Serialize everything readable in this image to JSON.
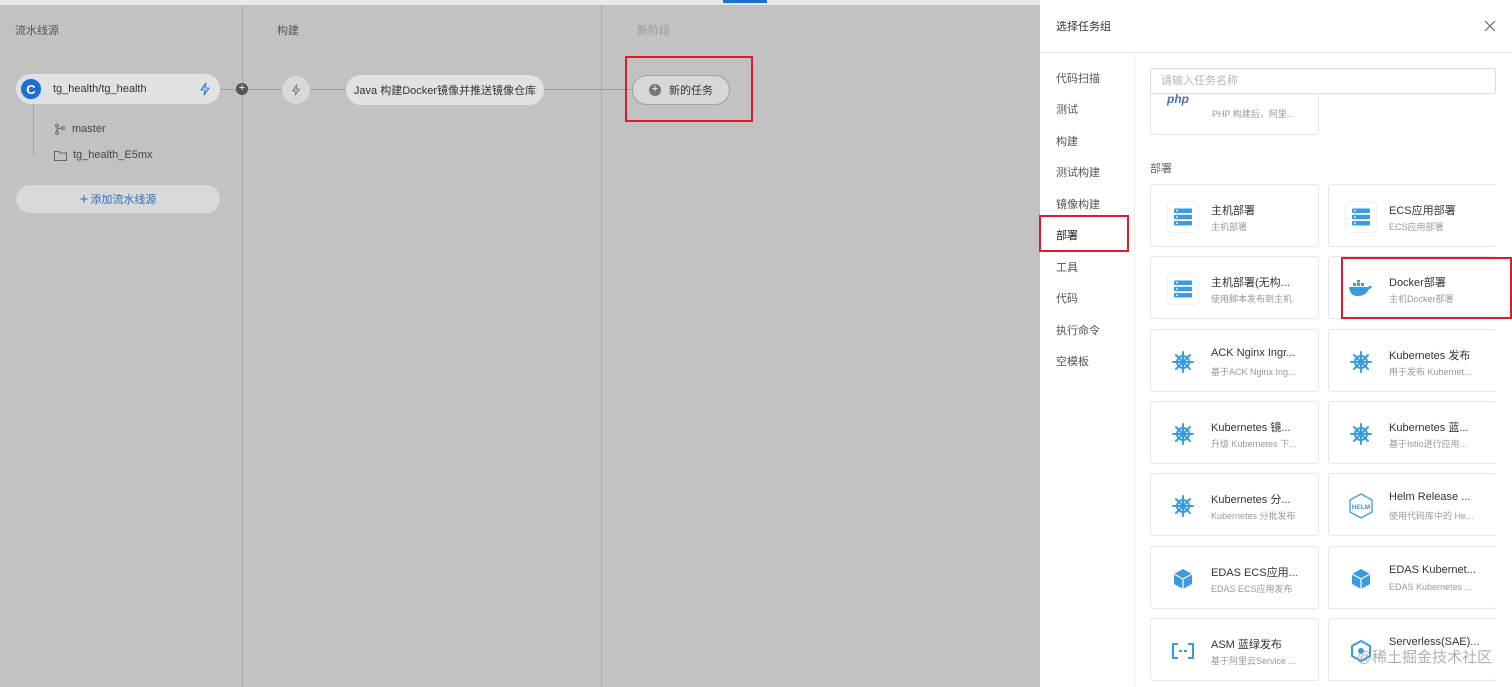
{
  "pipeline": {
    "columns": [
      "流水线源",
      "构建",
      "新阶段"
    ],
    "source": {
      "avatar_letter": "C",
      "name": "tg_health/tg_health",
      "branch": "master",
      "folder": "tg_health_E5mx",
      "add_button": "添加流水线源"
    },
    "build_job": "Java 构建Docker镜像并推送镜像仓库",
    "new_task": "新的任务"
  },
  "drawer": {
    "title": "选择任务组",
    "search_placeholder": "请输入任务名称",
    "categories": [
      "代码扫描",
      "测试",
      "构建",
      "测试构建",
      "镜像构建",
      "部署",
      "工具",
      "代码",
      "执行命令",
      "空模板"
    ],
    "active_category": "部署",
    "partial_card": {
      "icon": "php",
      "desc": "PHP 构建后，阿里..."
    },
    "section_title": "部署",
    "cards": [
      {
        "name": "主机部署",
        "desc": "主机部署",
        "icon": "server-icon"
      },
      {
        "name": "ECS应用部署",
        "desc": "ECS应用部署",
        "icon": "server-icon"
      },
      {
        "name": "主机部署(无构...",
        "desc": "使用脚本发布到主机",
        "icon": "server-icon"
      },
      {
        "name": "Docker部署",
        "desc": "主机Docker部署",
        "icon": "docker-icon"
      },
      {
        "name": "ACK Nginx Ingr...",
        "desc": "基于ACK Nginx Ing...",
        "icon": "kubernetes-icon"
      },
      {
        "name": "Kubernetes 发布",
        "desc": "用于发布 Kubernet...",
        "icon": "kubernetes-icon"
      },
      {
        "name": "Kubernetes 镜...",
        "desc": "升级 Kubernetes 下...",
        "icon": "kubernetes-icon"
      },
      {
        "name": "Kubernetes 蓝...",
        "desc": "基于Istio进行应用...",
        "icon": "kubernetes-icon"
      },
      {
        "name": "Kubernetes 分...",
        "desc": "Kubernetes 分批发布",
        "icon": "kubernetes-icon"
      },
      {
        "name": "Helm Release ...",
        "desc": "使用代码库中的 He...",
        "icon": "helm-icon"
      },
      {
        "name": "EDAS ECS应用...",
        "desc": "EDAS ECS应用发布",
        "icon": "cube-icon"
      },
      {
        "name": "EDAS Kubernet...",
        "desc": "EDAS Kubernetes ...",
        "icon": "cube-icon"
      },
      {
        "name": "ASM 蓝绿发布",
        "desc": "基于阿里云Service ...",
        "icon": "asm-icon"
      },
      {
        "name": "Serverless(SAE)...",
        "desc": "",
        "icon": "serverless-icon"
      }
    ]
  },
  "watermark": "@稀土掘金技术社区",
  "colors": {
    "accent": "#1f6fd1",
    "highlight": "#e0192c",
    "icon_blue": "#3a9be0"
  }
}
